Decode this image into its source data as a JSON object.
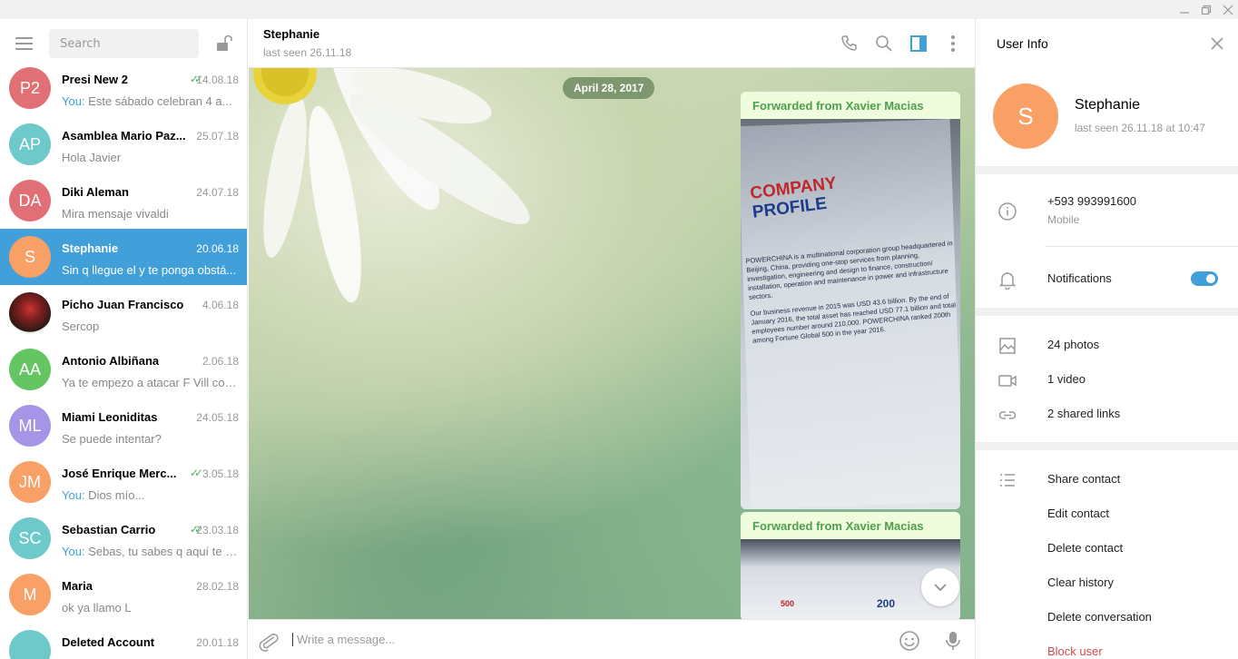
{
  "window": {
    "controls": [
      "minimize",
      "maximize",
      "close"
    ]
  },
  "sidebar": {
    "search_placeholder": "Search",
    "chats": [
      {
        "initials": "P2",
        "color": "#e17076",
        "name": "Presi New 2",
        "date": "14.08.18",
        "read": true,
        "you": "You:",
        "preview": " Este sábado celebran 4 a..."
      },
      {
        "initials": "AP",
        "color": "#6ec9cb",
        "name": "Asamblea Mario Paz...",
        "date": "25.07.18",
        "read": false,
        "you": "",
        "preview": "Hola Javier"
      },
      {
        "initials": "DA",
        "color": "#e17076",
        "name": "Diki Aleman",
        "date": "24.07.18",
        "read": false,
        "you": "",
        "preview": "Mira mensaje vivaldi"
      },
      {
        "initials": "S",
        "color": "#f9a067",
        "name": "Stephanie",
        "date": "20.06.18",
        "read": false,
        "you": "",
        "preview": "Sin q llegue el y te ponga obstá...",
        "active": true
      },
      {
        "initials": "",
        "color": "#5b3a2a",
        "name": "Picho Juan Francisco",
        "date": "4.06.18",
        "read": false,
        "you": "",
        "preview": "Sercop",
        "photo": true
      },
      {
        "initials": "AA",
        "color": "#65c563",
        "name": "Antonio Albiñana",
        "date": "2.06.18",
        "read": false,
        "you": "",
        "preview": "Ya te empezo a atacar F Vill con..."
      },
      {
        "initials": "ML",
        "color": "#a695e7",
        "name": "Miami Leoniditas",
        "date": "24.05.18",
        "read": false,
        "you": "",
        "preview": "Se puede intentar?"
      },
      {
        "initials": "JM",
        "color": "#f9a067",
        "name": "José Enrique Merc...",
        "date": "3.05.18",
        "read": true,
        "you": "You:",
        "preview": " Dios mío..."
      },
      {
        "initials": "SC",
        "color": "#6ec9cb",
        "name": "Sebastian Carrio",
        "date": "23.03.18",
        "read": true,
        "you": "You:",
        "preview": " Sebas, tu sabes q aquí te q..."
      },
      {
        "initials": "M",
        "color": "#f9a067",
        "name": "Maria",
        "date": "28.02.18",
        "read": false,
        "you": "",
        "preview": "ok ya llamo L"
      },
      {
        "initials": "",
        "color": "#6ec9cb",
        "name": "Deleted Account",
        "date": "20.01.18",
        "read": false,
        "you": "",
        "preview": ""
      }
    ]
  },
  "chat": {
    "name": "Stephanie",
    "status": "last seen 26.11.18",
    "date_pill": "April 28, 2017",
    "messages": [
      {
        "forwarded": "Forwarded from Xavier Macias",
        "photo_title_1": "COMPANY",
        "photo_title_2": "PROFILE",
        "photo_para_1": "POWERCHINA is a multinational corporation group headquartered in Beijing, China, providing one-stop services from planning, investigation, engineering and design to finance, construction/ installation, operation and maintenance in power and infrastructure sectors.",
        "photo_para_2": "Our business revenue in 2015 was USD 43.6 billion. By the end of January 2016, the total asset has reached USD 77.1 billion and total employees number around 210,000. POWERCHINA ranked 200th among Fortune Global 500 in the year 2016."
      },
      {
        "forwarded": "Forwarded from Xavier Macias",
        "photo_badges": [
          "500",
          "200"
        ]
      }
    ],
    "composer_placeholder": "Write a message..."
  },
  "user_info": {
    "title": "User Info",
    "initial": "S",
    "avatar_color": "#f9a067",
    "name": "Stephanie",
    "status": "last seen 26.11.18 at 10:47",
    "phone": "+593 993991600",
    "phone_label": "Mobile",
    "notifications_label": "Notifications",
    "notifications_on": true,
    "media": {
      "photos": "24 photos",
      "video": "1 video",
      "links": "2 shared links"
    },
    "actions": {
      "share": "Share contact",
      "edit": "Edit contact",
      "delete": "Delete contact",
      "clear": "Clear history",
      "delete_conv": "Delete conversation",
      "block": "Block user"
    }
  }
}
